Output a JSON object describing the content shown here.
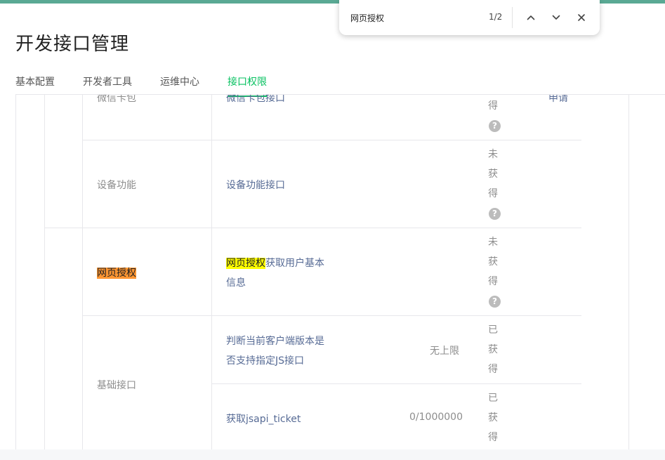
{
  "header": {
    "title": "开发接口管理"
  },
  "tabs": [
    {
      "label": "基本配置",
      "active": false
    },
    {
      "label": "开发者工具",
      "active": false
    },
    {
      "label": "运维中心",
      "active": false
    },
    {
      "label": "接口权限",
      "active": true
    }
  ],
  "find_bar": {
    "query": "网页授权",
    "count": "1/2"
  },
  "table": {
    "rows": [
      {
        "category": "微信卡包",
        "interface": "微信卡包接口",
        "quota": "",
        "status_tail": [
          "得"
        ],
        "action": "申请"
      },
      {
        "category": "设备功能",
        "interface": "设备功能接口",
        "quota": "",
        "status": [
          "未",
          "获",
          "得"
        ]
      },
      {
        "category": "网页授权",
        "interface_highlight": "网页授权",
        "interface_rest": "获取用户基本",
        "interface_line2": "信息",
        "quota": "",
        "status": [
          "未",
          "获",
          "得"
        ]
      },
      {
        "category": "基础接口",
        "sub_rows": [
          {
            "interface_line1": "判断当前客户端版本是",
            "interface_line2": "否支持指定JS接口",
            "quota": "无上限",
            "status": [
              "已",
              "获",
              "得"
            ]
          },
          {
            "interface": "获取jsapi_ticket",
            "quota": "0/1000000",
            "status": [
              "已",
              "获",
              "得"
            ]
          }
        ]
      }
    ]
  },
  "colors": {
    "accent": "#07c160",
    "link": "#576b95",
    "current_match": "#ff9632",
    "other_match": "#ffff00"
  }
}
